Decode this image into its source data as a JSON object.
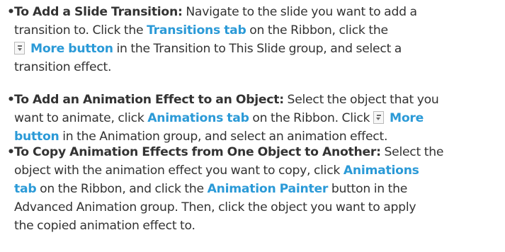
{
  "items": [
    {
      "bullet": "•",
      "lines": {
        "l1": {
          "title": "To Add a Slide Transition:",
          "t1": " Navigate to the slide you want to add a"
        },
        "l2": {
          "t1": "transition to. Click the ",
          "hl1": "Transitions tab",
          "t2": " on the Ribbon, click the"
        },
        "l3": {
          "hl1": "More button",
          "t1": " in the Transition to This Slide group, and select a"
        },
        "l4": {
          "t1": "transition effect."
        }
      }
    },
    {
      "bullet": "•",
      "lines": {
        "l1": {
          "title": "To Add an Animation Effect to an Object:",
          "t1": " Select the object that you"
        },
        "l2": {
          "t1": "want to animate, click ",
          "hl1": "Animations tab",
          "t2": " on the Ribbon. Click ",
          "hl2": "More"
        },
        "l3": {
          "hl1": "button",
          "t1": " in the Animation group, and select an animation effect."
        }
      }
    },
    {
      "bullet": "•",
      "lines": {
        "l1": {
          "title": "To Copy Animation Effects from One Object to Another:",
          "t1": " Select the"
        },
        "l2": {
          "t1": "object with the animation effect you want to copy, click ",
          "hl1": "Animations"
        },
        "l3": {
          "hl1": "tab",
          "t1": " on the Ribbon, and click the ",
          "hl2": "Animation Painter",
          "t2": " button in the"
        },
        "l4": {
          "t1": "Advanced Animation group. Then, click the object you want to apply"
        },
        "l5": {
          "t1": "the copied animation effect to."
        }
      }
    }
  ],
  "icons": {
    "more_button": "more-gallery-icon"
  }
}
